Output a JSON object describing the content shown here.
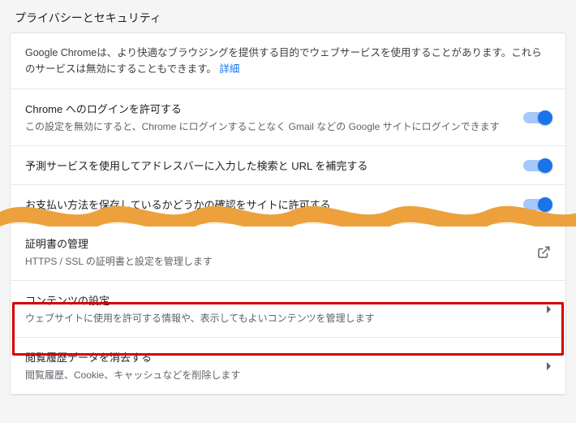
{
  "page": {
    "title": "プライバシーとセキュリティ"
  },
  "intro": {
    "text": "Google Chromeは、より快適なブラウジングを提供する目的でウェブサービスを使用することがあります。これらのサービスは無効にすることもできます。",
    "link": "詳細"
  },
  "rows": {
    "login": {
      "title": "Chrome へのログインを許可する",
      "desc": "この設定を無効にすると、Chrome にログインすることなく Gmail などの Google サイトにログインできます"
    },
    "predict": {
      "title": "予測サービスを使用してアドレスバーに入力した検索と URL を補完する"
    },
    "payment": {
      "title": "お支払い方法を保存しているかどうかの確認をサイトに許可する"
    },
    "certs": {
      "title": "証明書の管理",
      "desc": "HTTPS / SSL の証明書と設定を管理します"
    },
    "content": {
      "title": "コンテンツの設定",
      "desc": "ウェブサイトに使用を許可する情報や、表示してもよいコンテンツを管理します"
    },
    "clear": {
      "title": "閲覧履歴データを消去する",
      "desc": "閲覧履歴、Cookie、キャッシュなどを削除します"
    }
  }
}
